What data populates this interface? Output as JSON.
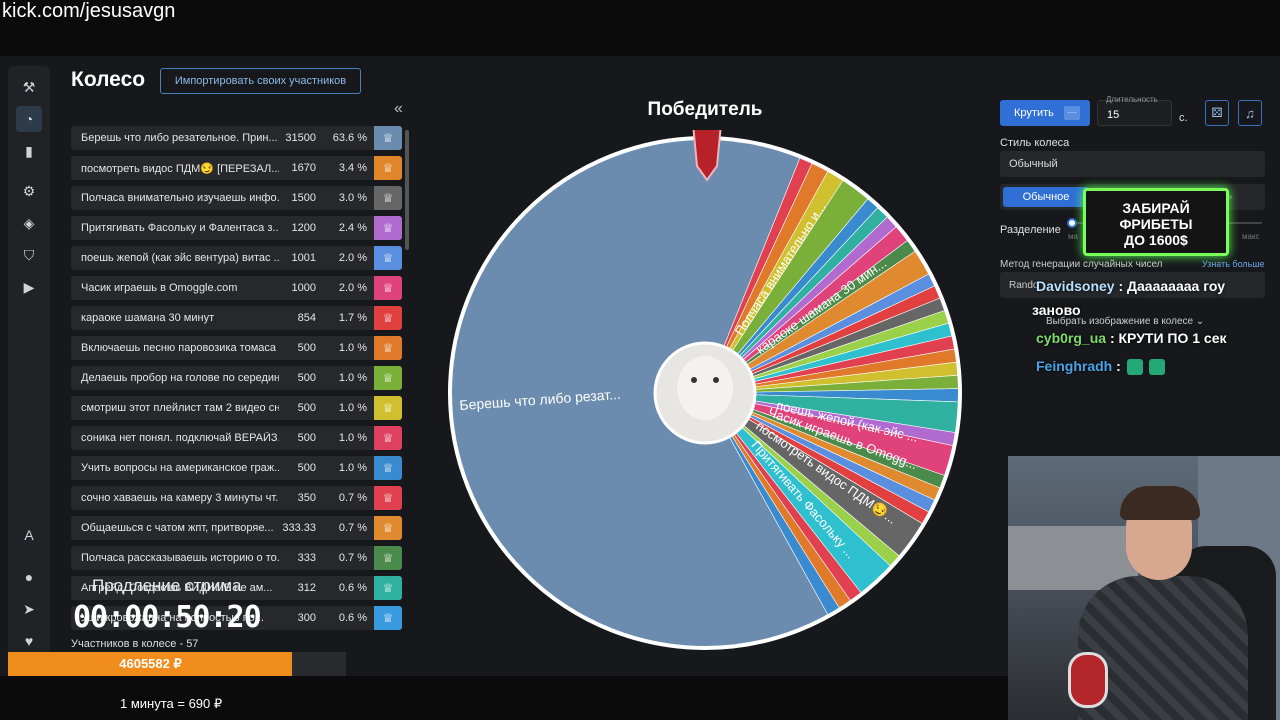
{
  "stream_url": "kick.com/jesusavgn",
  "app": {
    "title": "Колесо",
    "import_button": "Импортировать своих участников",
    "collapse_icon": "«",
    "participants_count": "Участников в колесе - 57"
  },
  "rail_icons": [
    "auction-icon",
    "wheel-icon",
    "stats-icon",
    "settings-icon",
    "layers-icon",
    "shield-icon",
    "video-icon",
    "translate-icon",
    "github-icon",
    "telegram-icon",
    "donate-icon"
  ],
  "participants": [
    {
      "name": "Берешь что либо резательное. Прин...",
      "amount": "31500",
      "pct": "63.6 %",
      "color": "#6b8cae"
    },
    {
      "name": "посмотреть видос ПДМ😏 [ПЕРЕЗАЛ...",
      "amount": "1670",
      "pct": "3.4 %",
      "color": "#e0862a"
    },
    {
      "name": "Полчаса внимательно изучаешь инфо...",
      "amount": "1500",
      "pct": "3.0 %",
      "color": "#666"
    },
    {
      "name": "Притягивать Фасольку и Фалентаса з...",
      "amount": "1200",
      "pct": "2.4 %",
      "color": "#b06ad0"
    },
    {
      "name": "поешь жепой (как эйс вентура) витас ...",
      "amount": "1001",
      "pct": "2.0 %",
      "color": "#5a8fe0"
    },
    {
      "name": "Часик играешь в Omoggle.com",
      "amount": "1000",
      "pct": "2.0 %",
      "color": "#e0437a"
    },
    {
      "name": "караоке шамана 30 минут",
      "amount": "854",
      "pct": "1.7 %",
      "color": "#e04040"
    },
    {
      "name": "Включаешь песню паровозика томаса ...",
      "amount": "500",
      "pct": "1.0 %",
      "color": "#e07a2a"
    },
    {
      "name": "Делаешь пробор на голове по середин...",
      "amount": "500",
      "pct": "1.0 %",
      "color": "#7ab03a"
    },
    {
      "name": "смотриш этот плейлист там 2 видео сн...",
      "amount": "500",
      "pct": "1.0 %",
      "color": "#d0c030"
    },
    {
      "name": "соника нет понял. подключай ВЕРАЙЗ...",
      "amount": "500",
      "pct": "1.0 %",
      "color": "#e04060"
    },
    {
      "name": "Учить вопросы на американское граж...",
      "amount": "500",
      "pct": "1.0 %",
      "color": "#3a8ad0"
    },
    {
      "name": "сочно хаваешь на камеру 3 минуты чт...",
      "amount": "350",
      "pct": "0.7 %",
      "color": "#e04050"
    },
    {
      "name": "Общаешься с чатом жпт, притворяе...",
      "amount": "333.33",
      "pct": "0.7 %",
      "color": "#e08a30"
    },
    {
      "name": "Полчаса рассказываешь историю о то...",
      "amount": "333",
      "pct": "0.7 %",
      "color": "#4a8a4a"
    },
    {
      "name": "Апгрейд. Создаешь ВИДИМЕ не ам...",
      "amount": "312",
      "pct": "0.6 %",
      "color": "#30b0a0"
    },
    {
      "name": "Уши кровожадна на полностью по...",
      "amount": "300",
      "pct": "0.6 %",
      "color": "#3a9ae0"
    }
  ],
  "stream_overlay": {
    "extension_label": "Продление стрима",
    "timer": "00:00:50:20",
    "total": "4605582 ₽",
    "rate": "1 минута = 690 ₽",
    "progress_fraction": 0.84
  },
  "wheel": {
    "winner_label": "Победитель",
    "main_label": "Берешь что либо резат...",
    "slice_labels": [
      "Полчаса внимательно и...",
      "караоке шамана 30 мин...",
      "поешь жепой (как эйс ...",
      "Часик играешь в Omogg...",
      "посмотреть видос ПДМ😏...",
      "Притягивать Фасольку ..."
    ]
  },
  "controls": {
    "spin_button": "Крутить",
    "spin_more": "···",
    "duration_label": "Длительность",
    "duration_value": "15",
    "seconds": "с.",
    "dice_icon": "dice-icon",
    "music_icon": "music-icon",
    "style_label": "Стиль колеса",
    "style_value": "Обычный",
    "tab_normal": "Обычное",
    "tab_other": "ль",
    "split_label": "Разделение",
    "slider_min": "ма",
    "slider_max": "макс",
    "rng_label": "Метод генерации случайных чисел",
    "rng_more": "Узнать больше",
    "rng_value": "Rando",
    "image_select": "Выбрать изображение в колесе ⌄"
  },
  "promo": {
    "line1": "ЗАБИРАЙ",
    "line2": "ФРИБЕТЫ",
    "line3": "ДО 1600$"
  },
  "chat": [
    {
      "user": "Davidsoney",
      "text": ": Даааааааа гоу",
      "text2": "заново"
    },
    {
      "user": "cyb0rg_ua",
      "text": ": КРУТИ ПО 1 сек"
    },
    {
      "user": "Feinghradh",
      "text": ":"
    }
  ]
}
